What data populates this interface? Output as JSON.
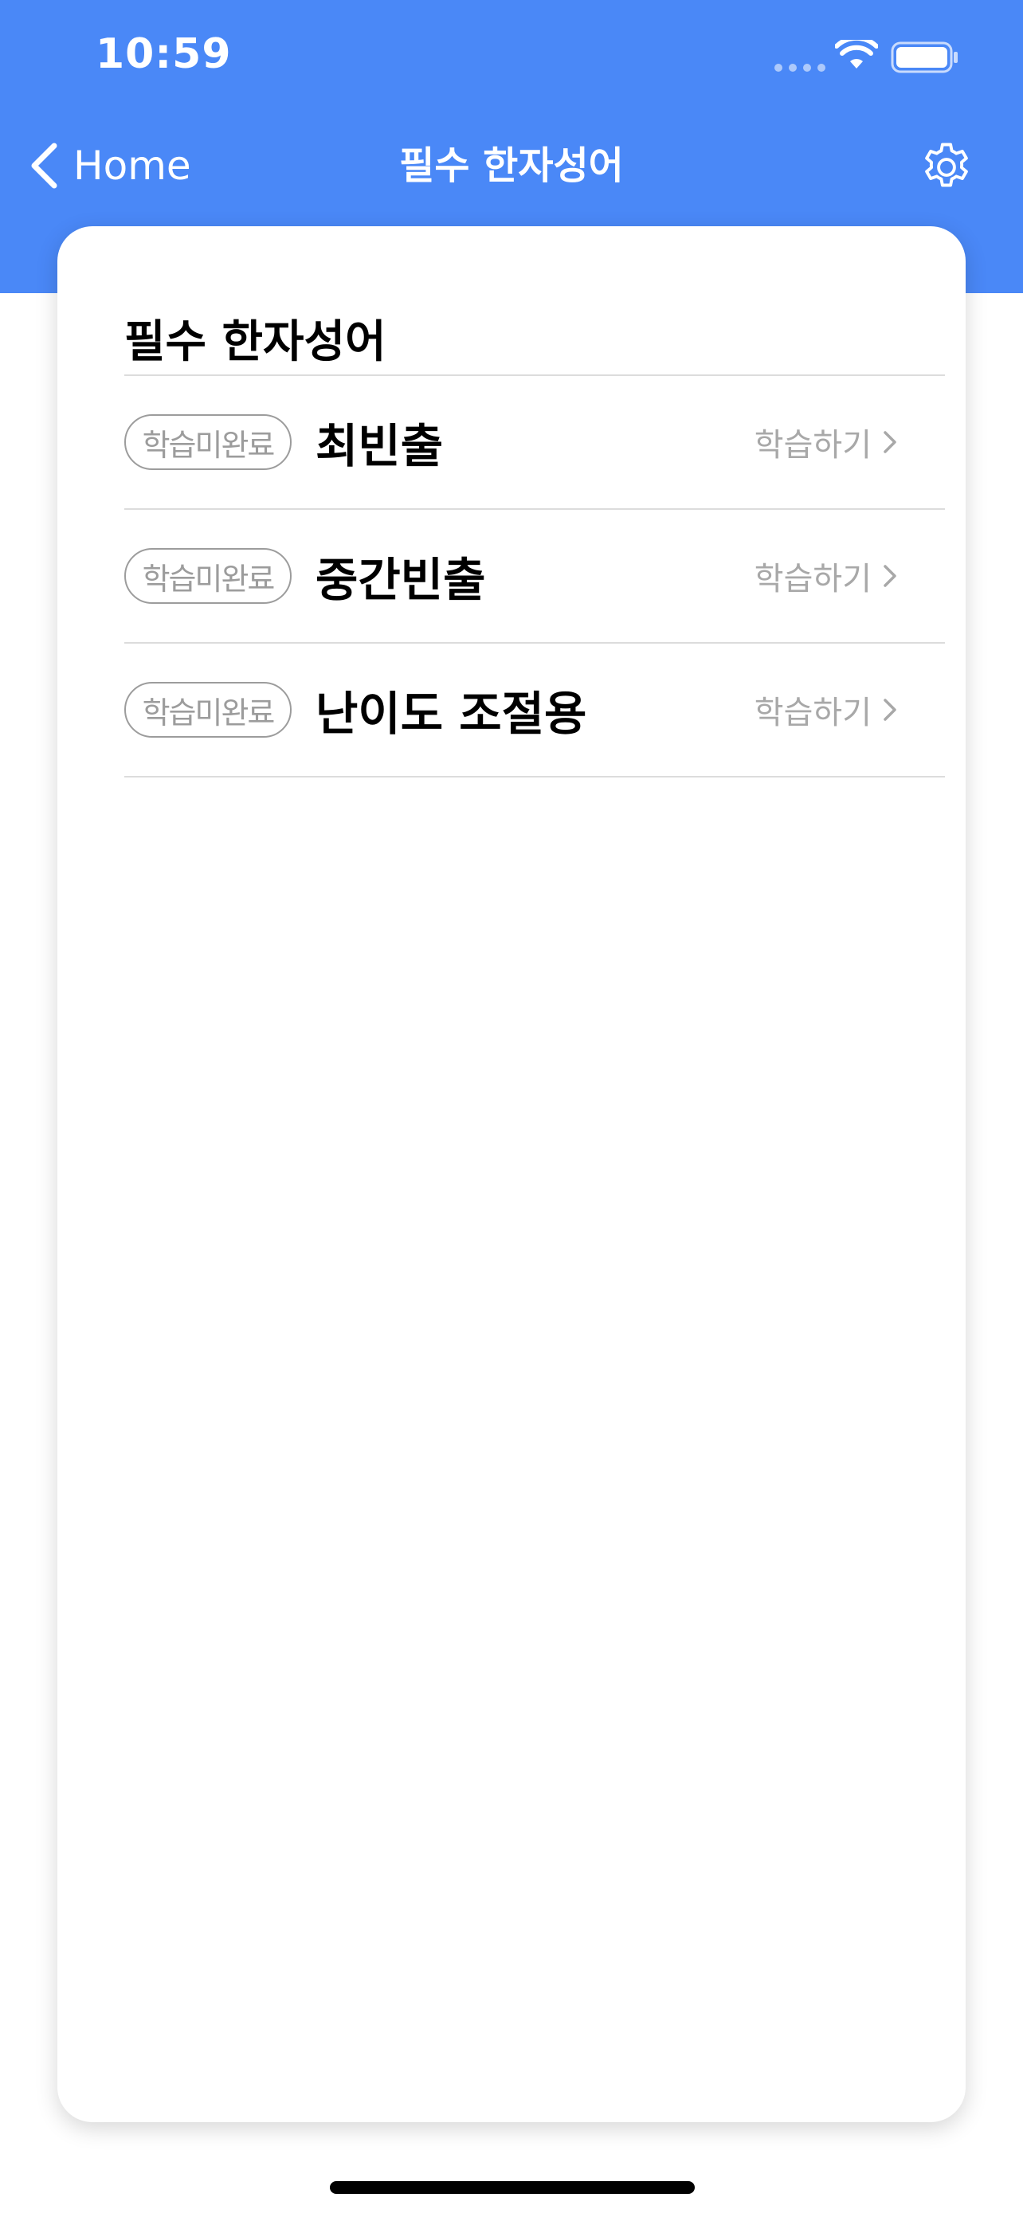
{
  "status_bar": {
    "time": "10:59"
  },
  "nav": {
    "back_label": "Home",
    "title": "필수 한자성어",
    "icons": {
      "back": "chevron-left-icon",
      "settings": "gear-icon"
    }
  },
  "card": {
    "title": "필수 한자성어",
    "items": [
      {
        "badge": "학습미완료",
        "title": "최빈출",
        "action": "학습하기"
      },
      {
        "badge": "학습미완료",
        "title": "중간빈출",
        "action": "학습하기"
      },
      {
        "badge": "학습미완료",
        "title": "난이도 조절용",
        "action": "학습하기"
      }
    ]
  },
  "colors": {
    "header_background": "#4a88f7",
    "badge_outline": "#9c9c9c",
    "action_text": "#a8a8a8"
  }
}
